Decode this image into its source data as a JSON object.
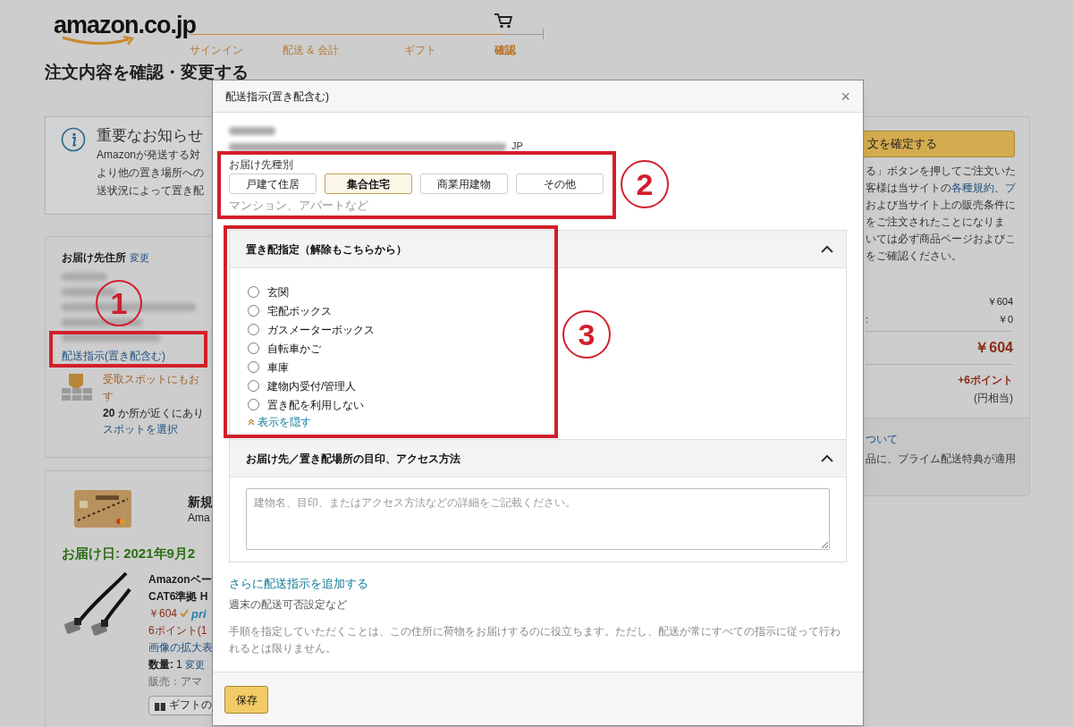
{
  "header": {
    "logo": "amazon.co.jp",
    "steps": [
      {
        "label": "サインイン",
        "current": false
      },
      {
        "label": "配送 & 会計",
        "current": false
      },
      {
        "label": "ギフト",
        "current": false
      },
      {
        "label": "確認",
        "current": true
      }
    ]
  },
  "page_title": "注文内容を確認・変更する",
  "notice": {
    "title": "重要なお知らせ",
    "lines": [
      "Amazonが発送する対",
      "より他の置き場所への",
      "送状況によって置き配"
    ]
  },
  "address": {
    "heading": "お届け先住所",
    "change_link": "変更",
    "instructions_link": "配送指示(置き配含む)",
    "pickup_lines": [
      "受取スポットにもお",
      "す"
    ],
    "pickup_count": "**20** か所が近くにあり",
    "pickup_link": "スポットを選択"
  },
  "card_offer": {
    "title": "新規",
    "subtitle": "Ama"
  },
  "delivery_date": "お届け日: 2021年9月2",
  "item": {
    "name_lines": [
      "Amazonベー",
      "CAT6準拠 H"
    ],
    "price": "￥604",
    "prime": "pri",
    "points": "6ポイント(1",
    "image_link": "画像の拡大表",
    "quantity_label": "数量:",
    "quantity": "1",
    "quantity_change": "変更",
    "seller": "販売：アマ",
    "gift_button": "ギフトの"
  },
  "summary": {
    "place_order": "文を確定する",
    "terms_lines": [
      [
        {
          "text": "る」ボタンを押してご注文いた",
          "link": false
        }
      ],
      [
        {
          "text": "客様は当サイトの",
          "link": false
        },
        {
          "text": "各種規約",
          "link": true
        },
        {
          "text": "、",
          "link": false
        },
        {
          "text": "プ",
          "link": true
        }
      ],
      [
        {
          "text": "および当サイト上の販売条件に",
          "link": false
        }
      ],
      [
        {
          "text": "をご注文されたことになりま",
          "link": false
        }
      ],
      [
        {
          "text": "いては必ず商品ページおよび",
          "link": false
        },
        {
          "text": "こ",
          "link": true
        }
      ],
      [
        {
          "text": "をご確認ください。",
          "link": false
        }
      ]
    ],
    "rows": [
      {
        "value": "￥604"
      },
      {
        "label": ":",
        "value": "￥0"
      }
    ],
    "total": "￥604",
    "points": "+6ポイント",
    "points_note": "(円相当)",
    "prime_link": "ついて",
    "prime_note": "品に、プライム配送特典が適用"
  },
  "dialog": {
    "title": "配送指示(置き配含む)",
    "close": "×",
    "address_suffix": "JP",
    "type_label": "お届け先種別",
    "types": [
      {
        "label": "戸建て住居",
        "selected": false
      },
      {
        "label": "集合住宅",
        "selected": true
      },
      {
        "label": "商業用建物",
        "selected": false
      },
      {
        "label": "その他",
        "selected": false
      }
    ],
    "type_hint": "マンション、アパートなど",
    "sections": [
      {
        "kind": "radios",
        "title": "置き配指定（解除もこちらから）",
        "expanded": true,
        "options": [
          {
            "label": "玄関",
            "selected": false
          },
          {
            "label": "宅配ボックス",
            "selected": false
          },
          {
            "label": "ガスメーターボックス",
            "selected": false
          },
          {
            "label": "自転車かご",
            "selected": false
          },
          {
            "label": "車庫",
            "selected": false
          },
          {
            "label": "建物内受付/管理人",
            "selected": false
          },
          {
            "label": "置き配を利用しない",
            "selected": false
          }
        ],
        "toggle_link": "表示を隠す"
      },
      {
        "kind": "textarea",
        "title": "お届け先／置き配場所の目印、アクセス方法",
        "expanded": true,
        "placeholder": "建物名、目印、またはアクセス方法などの詳細をご記載ください。"
      }
    ],
    "more_link": "さらに配送指示を追加する",
    "more_note": "週末の配送可否設定など",
    "disclaimer": "手順を指定していただくことは、この住所に荷物をお届けするのに役立ちます。ただし、配送が常にすべての指示に従って行われるとは限りません。",
    "save_button": "保存"
  },
  "annotations": [
    {
      "number": "1"
    },
    {
      "number": "2"
    },
    {
      "number": "3"
    }
  ]
}
